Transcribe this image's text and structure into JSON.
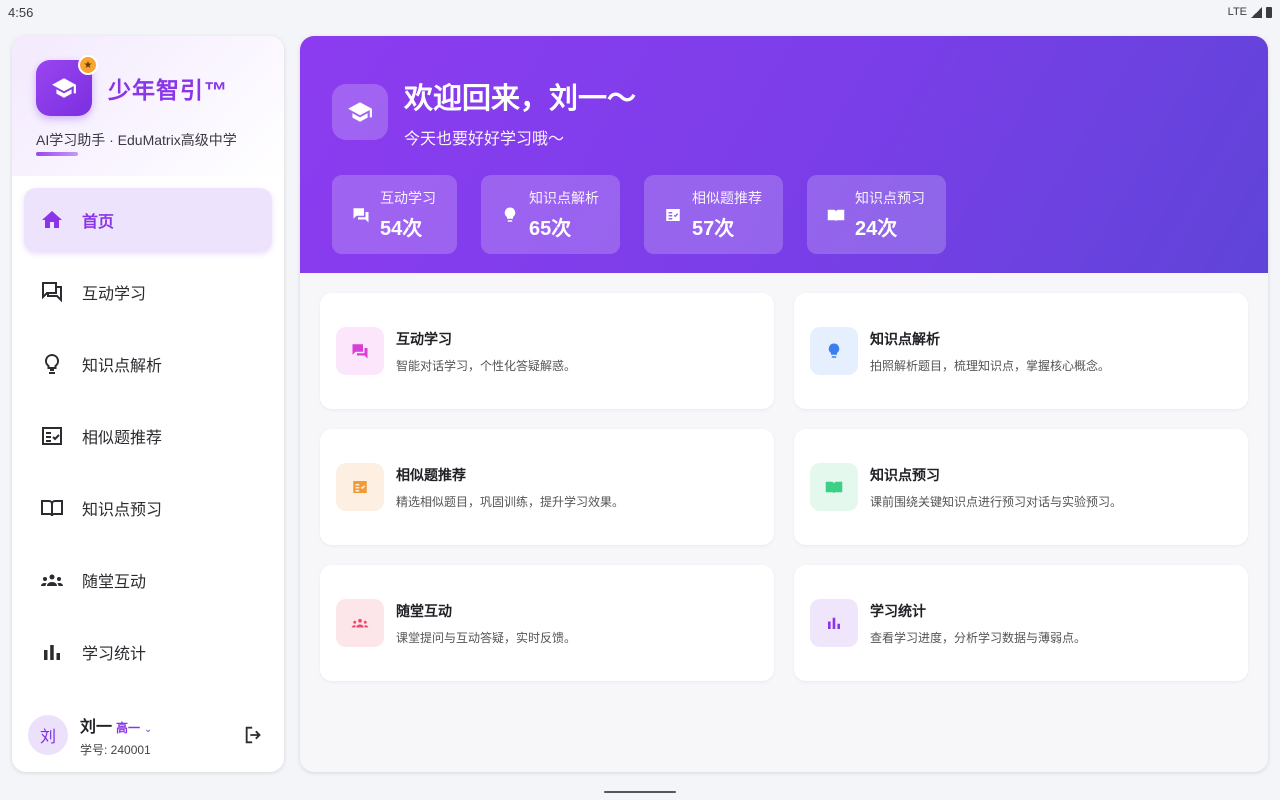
{
  "status": {
    "time": "4:56",
    "network": "LTE"
  },
  "brand": {
    "name": "少年智引™",
    "subtitle": "AI学习助手 · EduMatrix高级中学",
    "accent": "#8a35e8"
  },
  "nav": [
    {
      "label": "首页",
      "icon": "home-icon",
      "active": true
    },
    {
      "label": "互动学习",
      "icon": "chat-icon"
    },
    {
      "label": "知识点解析",
      "icon": "lightbulb-icon"
    },
    {
      "label": "相似题推荐",
      "icon": "checklist-icon"
    },
    {
      "label": "知识点预习",
      "icon": "book-icon"
    },
    {
      "label": "随堂互动",
      "icon": "group-icon"
    },
    {
      "label": "学习统计",
      "icon": "bar-chart-icon"
    }
  ],
  "user": {
    "avatar_text": "刘",
    "name": "刘一",
    "grade": "高一",
    "student_id": "学号: 240001"
  },
  "hero": {
    "title": "欢迎回来，刘一～",
    "subtitle": "今天也要好好学习哦～",
    "stats": [
      {
        "label": "互动学习",
        "value": "54次",
        "icon": "chat-icon"
      },
      {
        "label": "知识点解析",
        "value": "65次",
        "icon": "lightbulb-icon"
      },
      {
        "label": "相似题推荐",
        "value": "57次",
        "icon": "checklist-icon"
      },
      {
        "label": "知识点预习",
        "value": "24次",
        "icon": "book-icon"
      }
    ]
  },
  "cards": [
    {
      "title": "互动学习",
      "desc": "智能对话学习，个性化答疑解惑。",
      "icon": "chat-icon",
      "color": "#d63fd6",
      "bg": "#fbe6fb"
    },
    {
      "title": "知识点解析",
      "desc": "拍照解析题目，梳理知识点，掌握核心概念。",
      "icon": "lightbulb-icon",
      "color": "#3b7ef0",
      "bg": "#e6effd"
    },
    {
      "title": "相似题推荐",
      "desc": "精选相似题目，巩固训练，提升学习效果。",
      "icon": "checklist-icon",
      "color": "#f29a38",
      "bg": "#fdf0e2"
    },
    {
      "title": "知识点预习",
      "desc": "课前围绕关键知识点进行预习对话与实验预习。",
      "icon": "book-icon",
      "color": "#3ccf86",
      "bg": "#e4f8ee"
    },
    {
      "title": "随堂互动",
      "desc": "课堂提问与互动答疑，实时反馈。",
      "icon": "group-icon",
      "color": "#ee4c6c",
      "bg": "#fde6ea"
    },
    {
      "title": "学习统计",
      "desc": "查看学习进度，分析学习数据与薄弱点。",
      "icon": "bar-chart-icon",
      "color": "#8a35e8",
      "bg": "#efe6fc"
    }
  ]
}
